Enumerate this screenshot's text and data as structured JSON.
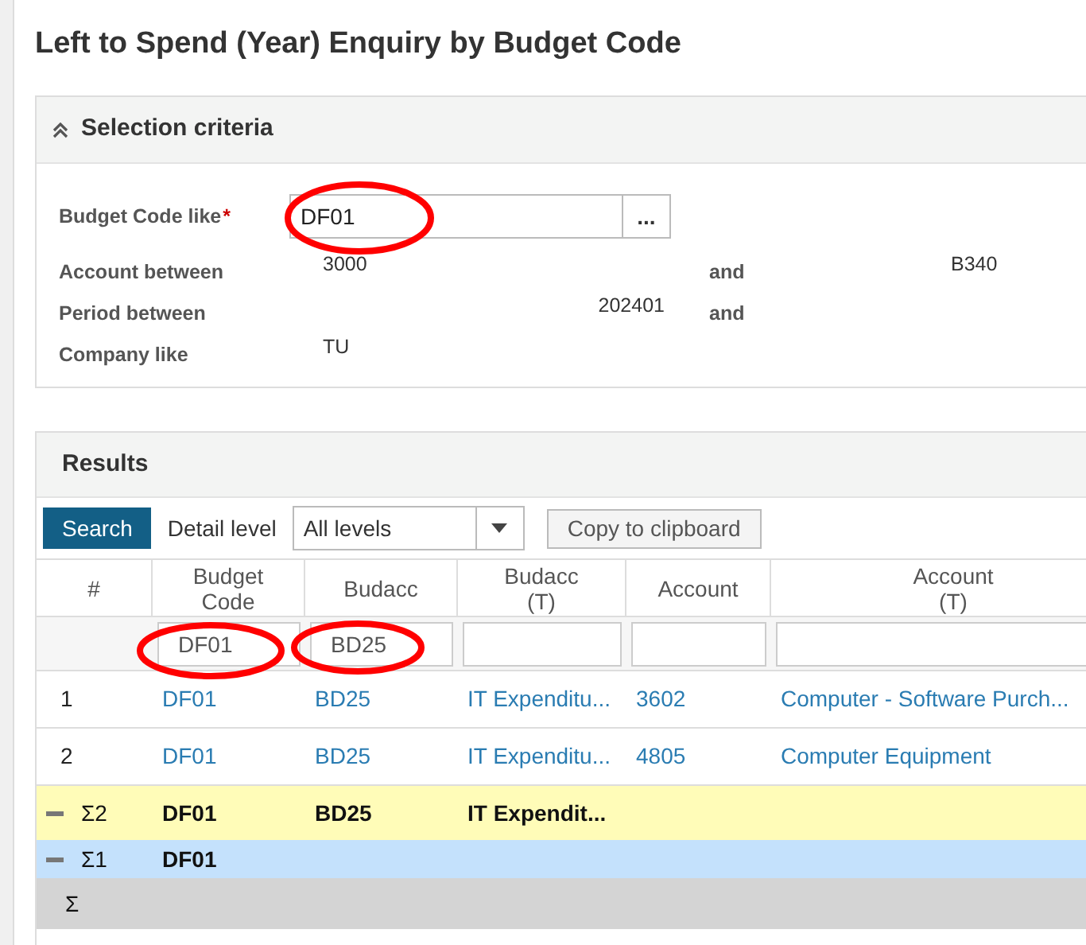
{
  "title": "Left to Spend (Year) Enquiry by Budget Code",
  "selection": {
    "title": "Selection criteria",
    "expanded": true,
    "budget_code": {
      "label": "Budget Code like",
      "required_mark": "*",
      "value": "DF01",
      "lookup": "..."
    },
    "account": {
      "label": "Account between",
      "from": "3000",
      "and": "and",
      "to": "B340"
    },
    "period": {
      "label": "Period between",
      "from": "202401",
      "and": "and"
    },
    "company": {
      "label": "Company like",
      "value": "TU"
    }
  },
  "results": {
    "title": "Results",
    "search_button": "Search",
    "detail_label": "Detail level",
    "detail_value": "All levels",
    "copy_button": "Copy to clipboard",
    "columns": [
      "#",
      "Budget\nCode",
      "Budacc",
      "Budacc\n(T)",
      "Account",
      "Account\n(T)"
    ],
    "filters": [
      "DF01",
      "BD25"
    ],
    "rows": [
      {
        "kind": "data",
        "cells": [
          "1",
          "DF01",
          "BD25",
          "IT Expenditu...",
          "3602",
          "Computer - Software Purch..."
        ]
      },
      {
        "kind": "data",
        "cells": [
          "2",
          "DF01",
          "BD25",
          "IT Expenditu...",
          "4805",
          "Computer Equipment"
        ]
      },
      {
        "kind": "subtotal",
        "expanded": true,
        "color": "#fffcb8",
        "cells": [
          "Σ2",
          "DF01",
          "BD25",
          "IT Expendit..."
        ]
      },
      {
        "kind": "subtotal",
        "expanded": true,
        "color": "#c4e1fc",
        "cells": [
          "Σ1",
          "DF01"
        ]
      },
      {
        "kind": "total",
        "color": "#d4d4d4",
        "cells": [
          "Σ"
        ]
      }
    ]
  }
}
